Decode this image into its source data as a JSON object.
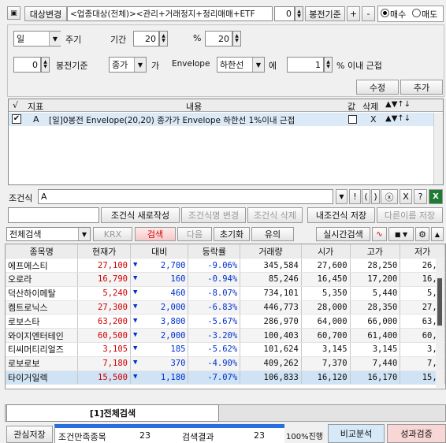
{
  "toolbar": {
    "target_label": "대상변경",
    "target_value": "<업종대상(전체)><관리+거래정지+정리매매+ETF",
    "candle_value": "0",
    "candle_label": "봉전기준",
    "plus": "+",
    "minus": "-",
    "buy": "매수",
    "sell": "매도"
  },
  "condition": {
    "period_value": "일",
    "period_label": "주기",
    "term_label": "기간",
    "term1": "20",
    "pct_label": "%",
    "term2": "20",
    "offset_value": "0",
    "offset_label": "봉전기준",
    "price_value": "종가",
    "ga": "가",
    "indicator": "Envelope",
    "band_value": "하한선",
    "e": "에",
    "pct_value": "1",
    "pct_suffix": "% 이내 근접",
    "modify_btn": "수정",
    "add_btn": "추가"
  },
  "list": {
    "headers": {
      "check": "√",
      "index": "지표",
      "content": "내용",
      "value": "값",
      "delete": "삭제"
    },
    "row": {
      "index": "A",
      "content": "[일]0봉전 Envelope(20,20) 종가가 Envelope 하한선 1%이내 근접",
      "delete": "X"
    }
  },
  "formula": {
    "label": "조건식",
    "value": "A",
    "ops": [
      "!",
      "(",
      ")",
      "ⓧ",
      "X",
      "?"
    ]
  },
  "cond_btns": {
    "new": "조건식 새로작성",
    "edit": "조건식명 변경",
    "del": "조건식 삭제",
    "my_save": "내조건식 저장",
    "save_as": "다른이름 저장"
  },
  "search": {
    "scope": "전체검색",
    "krx": "KRX",
    "search": "검색",
    "next": "다음",
    "reset": "초기화",
    "caution": "유의",
    "realtime": "실시간검색"
  },
  "grid": {
    "headers": [
      "종목명",
      "현재가",
      "대비",
      "등락률",
      "거래량",
      "시가",
      "고가",
      "저가"
    ],
    "rows": [
      {
        "name": "에프에스티",
        "price": "27,100",
        "diff": "2,700",
        "rate": "-9.06%",
        "vol": "345,584",
        "open": "27,600",
        "high": "28,250",
        "low": "26,2"
      },
      {
        "name": "오로라",
        "price": "16,790",
        "diff": "160",
        "rate": "-0.94%",
        "vol": "85,246",
        "open": "16,450",
        "high": "17,200",
        "low": "16,0"
      },
      {
        "name": "덕산하이메탈",
        "price": "5,240",
        "diff": "460",
        "rate": "-8.07%",
        "vol": "734,101",
        "open": "5,350",
        "high": "5,440",
        "low": "5,2"
      },
      {
        "name": "켐트로닉스",
        "price": "27,300",
        "diff": "2,000",
        "rate": "-6.83%",
        "vol": "446,773",
        "open": "28,000",
        "high": "28,350",
        "low": "27,1"
      },
      {
        "name": "로보스타",
        "price": "63,200",
        "diff": "3,800",
        "rate": "-5.67%",
        "vol": "286,970",
        "open": "64,000",
        "high": "66,000",
        "low": "63,0"
      },
      {
        "name": "와이지엔터테인",
        "price": "60,500",
        "diff": "2,000",
        "rate": "-3.20%",
        "vol": "100,403",
        "open": "60,700",
        "high": "61,400",
        "low": "60,1"
      },
      {
        "name": "티씨머티리얼즈",
        "price": "3,105",
        "diff": "185",
        "rate": "-5.62%",
        "vol": "101,624",
        "open": "3,145",
        "high": "3,145",
        "low": "3,0"
      },
      {
        "name": "로보로보",
        "price": "7,180",
        "diff": "370",
        "rate": "-4.90%",
        "vol": "409,262",
        "open": "7,370",
        "high": "7,440",
        "low": "7,1"
      },
      {
        "name": "타이거일렉",
        "price": "15,500",
        "diff": "1,180",
        "rate": "-7.07%",
        "vol": "106,833",
        "open": "16,120",
        "high": "16,170",
        "low": "15,3"
      }
    ]
  },
  "tab": {
    "label": "[1]전체검색"
  },
  "status": {
    "watch_save": "관심저장",
    "match_label": "조건만족종목",
    "match_count": "23",
    "result_label": "검색결과",
    "result_count": "23",
    "progress": "100%진행",
    "progress_value": 1.0,
    "compare": "비교분석",
    "perf": "성과검증"
  }
}
